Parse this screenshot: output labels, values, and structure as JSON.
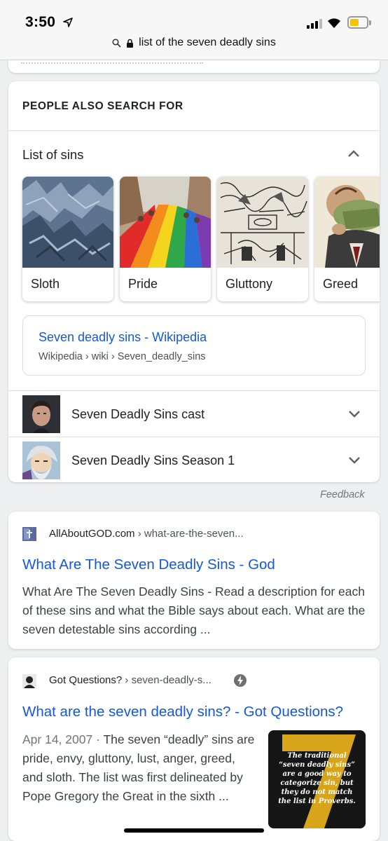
{
  "status_bar": {
    "time": "3:50",
    "battery_level": 0.4,
    "battery_color": "#f5c400"
  },
  "url_bar": {
    "text": "list of the seven deadly sins",
    "search_icon": "search-icon",
    "lock_icon": "lock-icon"
  },
  "people_also_search": {
    "title": "PEOPLE ALSO SEARCH FOR",
    "list_label": "List of sins",
    "sins": [
      {
        "label": "Sloth"
      },
      {
        "label": "Pride"
      },
      {
        "label": "Gluttony"
      },
      {
        "label": "Greed"
      }
    ],
    "wiki_link": {
      "title": "Seven deadly sins - Wikipedia",
      "crumb": "Wikipedia › wiki › Seven_deadly_sins"
    },
    "related": [
      {
        "label": "Seven Deadly Sins cast"
      },
      {
        "label": "Seven Deadly Sins Season 1"
      }
    ]
  },
  "feedback": "Feedback",
  "results": [
    {
      "site": "AllAboutGOD.com",
      "path": " › what-are-the-seven...",
      "title": "What Are The Seven Deadly Sins - God",
      "snippet": "What Are The Seven Deadly Sins - Read a description for each of these sins and what the Bible says about each. What are the seven detestable sins according ..."
    },
    {
      "site": "Got Questions?",
      "path": " › seven-deadly-s...",
      "title": "What are the seven deadly sins? - Got Questions?",
      "date": "Apr 14, 2007 · ",
      "snippet": "The seven “deadly” sins are pride, envy, gluttony, lust, anger, greed, and sloth. The list was first delineated by Pope Gregory the Great in the sixth ...",
      "thumb_text": "The traditional “seven deadly sins” are a good way to categorize sin, but they do not match the list in Proverbs."
    }
  ],
  "colors": {
    "link": "#1558d6",
    "background": "#eeeff1"
  }
}
